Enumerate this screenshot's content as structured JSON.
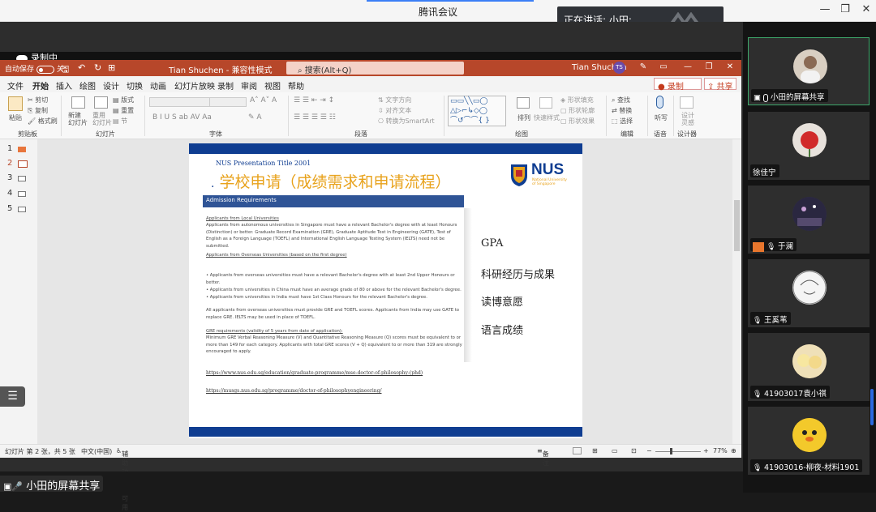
{
  "app": {
    "title": "腾讯会议"
  },
  "speaker": {
    "label": "正在讲话: 小田;"
  },
  "recording": {
    "label": "录制中"
  },
  "ppt": {
    "autosave": "自动保存",
    "autosave_state": "关",
    "doc_title": "Tian Shuchen  -  兼容性模式",
    "search_placeholder": "搜索(Alt+Q)",
    "user_name": "Tian Shuchen",
    "user_initials": "TS",
    "menus": [
      "文件",
      "开始",
      "插入",
      "绘图",
      "设计",
      "切换",
      "动画",
      "幻灯片放映",
      "录制",
      "审阅",
      "视图",
      "帮助"
    ],
    "active_menu": "开始",
    "record_btn": "● 录制",
    "share_btn": "⇪ 共享",
    "ribbon_groups": [
      "剪贴板",
      "幻灯片",
      "字体",
      "段落",
      "绘图",
      "编辑",
      "语音",
      "设计器"
    ],
    "ribbon_labels": {
      "paste": "粘贴",
      "cut": "剪切",
      "copy": "复制",
      "format_painter": "格式刷",
      "new_slide": "新建\n幻灯片",
      "reuse": "重用\n幻灯片",
      "layout": "版式",
      "reset": "重置",
      "section": "节",
      "text_dir": "文字方向",
      "align_text": "对齐文本",
      "smartart": "转换为SmartArt",
      "arrange": "排列",
      "quick_styles": "快速样式",
      "shape_fill": "形状填充",
      "shape_outline": "形状轮廓",
      "shape_effects": "形状效果",
      "find": "查找",
      "replace": "替换",
      "select": "选择",
      "dictate": "听写",
      "design_ideas": "设计\n灵感"
    },
    "thumbs": [
      "1",
      "2",
      "3",
      "4",
      "5"
    ],
    "status": {
      "slide_count": "幻灯片 第 2 张，共 5 张",
      "language": "中文(中国)",
      "accessibility": "辅助功能: 不可用",
      "notes": "备注",
      "comments": "",
      "zoom": "77%"
    }
  },
  "slide": {
    "subtitle": "NUS Presentation Title 2001",
    "title": "学校申请（成绩需求和申请流程）",
    "bullet": ".",
    "logo_text": "NUS",
    "logo_sub1": "National University",
    "logo_sub2": "of Singapore",
    "panel_header": "Admission Requirements",
    "local_heading": "Applicants from Local Universities",
    "local_text": "Applicants from autonomous universities in Singapore must have a relevant Bachelor's degree with at least Honours (Distinction) or better. Graduate Record Examination (GRE), Graduate Aptitude Test in Engineering (GATE), Test of English as a Foreign Language (TOEFL) and International English Language Testing System (IELTS) need not be submitted.",
    "overseas_heading": "Applicants from Overseas Universities (based on the first degree)",
    "overseas_b1": "• Applicants from overseas universities must have a relevant Bachelor's degree with at least 2nd Upper Honours or better.",
    "overseas_b2": "• Applicants from universities in China must have an average grade of 80 or above for the relevant Bachelor's degree.",
    "overseas_b3": "• Applicants from universities in India must have 1st Class Honours for the relevant Bachelor's degree.",
    "overseas_note": "All applicants from overseas universities must provide GRE and TOEFL scores. Applicants from India may use GATE to replace GRE. IELTS may be used in place of TOEFL.",
    "gre_heading": "GRE requirements (validity of 5 years from date of application):",
    "gre_text": "Minimum GRE Verbal Reasoning Measure (V) and Quantitative Reasoning Measure (Q) scores must be equivalent to or more than 149 for each category. Applicants with total GRE scores (V + Q) equivalent to or more than 319 are strongly encouraged to apply.",
    "url1": "https://www.nus.edu.sg/education/graduate-programme/mse-doctor-of-philosophy-(phd)",
    "url2": "https://musgs.nus.edu.sg/programme/doctor-of-philosophyengineering/",
    "right_items": [
      "GPA",
      "科研经历与成果",
      "读博意愿",
      "语言成绩"
    ]
  },
  "bottom": {
    "screen_share_label": "小田的屏幕共享"
  },
  "participants": [
    {
      "name": "小田的屏幕共享",
      "mic": "sharing",
      "avatar_color": "#d9cfc2"
    },
    {
      "name": "徐佳宁",
      "mic": "none",
      "avatar_color": "#e8e2dc"
    },
    {
      "name": "于澜",
      "mic": "muted",
      "avatar_color": "#3a3550"
    },
    {
      "name": "王奚苇",
      "mic": "muted",
      "avatar_color": "#f2f2f2"
    },
    {
      "name": "41903017袁小祺",
      "mic": "muted",
      "avatar_color": "#e9d4a6"
    },
    {
      "name": "41903016-柳夜-材料1901",
      "mic": "muted",
      "avatar_color": "#f3c92b"
    }
  ],
  "colors": {
    "ppt_red": "#b7472a",
    "nus_blue": "#0f3d91",
    "title_orange": "#e8a21b"
  }
}
